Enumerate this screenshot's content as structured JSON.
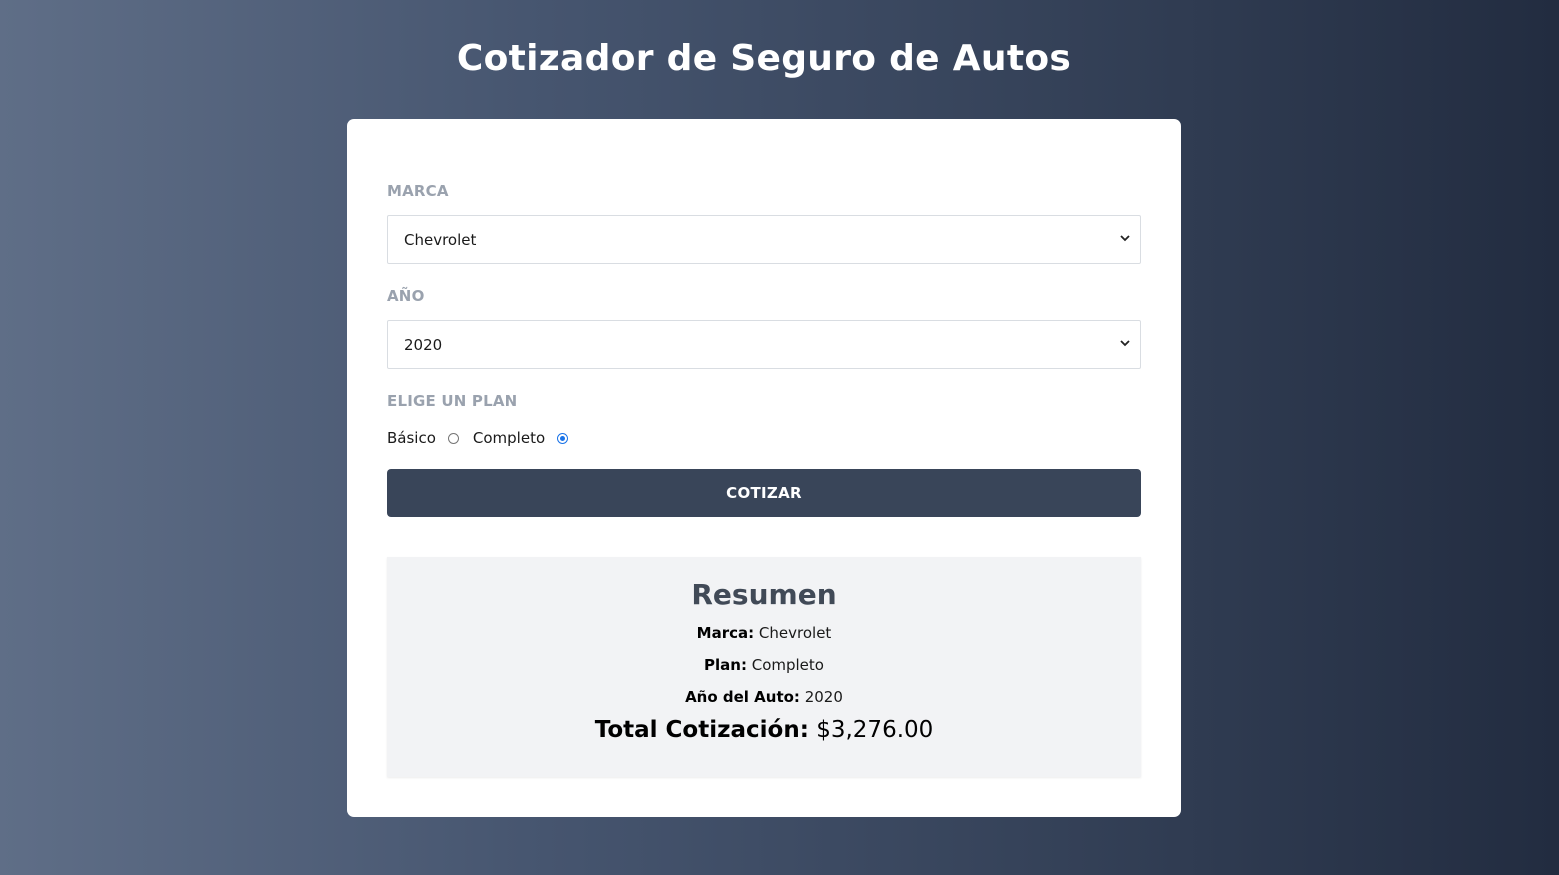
{
  "page": {
    "title": "Cotizador de Seguro de Autos"
  },
  "form": {
    "marca_label": "MARCA",
    "marca_value": "Chevrolet",
    "year_label": "AÑO",
    "year_value": "2020",
    "plan_label": "ELIGE UN PLAN",
    "plan_options": [
      {
        "label": "Básico",
        "checked": false
      },
      {
        "label": "Completo",
        "checked": true
      }
    ],
    "submit_label": "COTIZAR"
  },
  "summary": {
    "title": "Resumen",
    "marca_key": "Marca:",
    "marca_value": "Chevrolet",
    "plan_key": "Plan:",
    "plan_value": "Completo",
    "year_key": "Año del Auto:",
    "year_value": "2020",
    "total_key": "Total Cotización:",
    "total_value": "$3,276.00"
  },
  "colors": {
    "button": "#394559",
    "radio_accent": "#1a73e8",
    "summary_bg": "#f2f3f5"
  }
}
